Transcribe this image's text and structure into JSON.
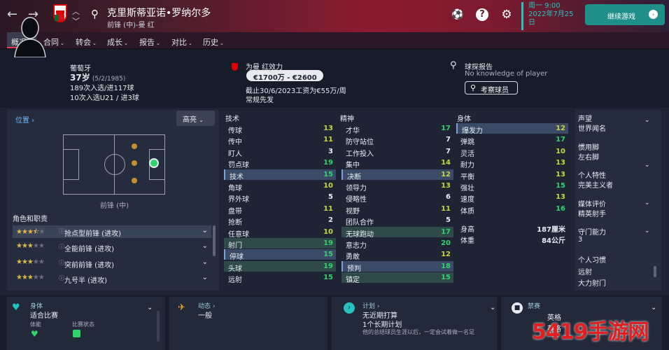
{
  "topbar": {
    "back": "←",
    "forward": "→",
    "player_name": "克里斯蒂亚诺•罗纳尔多",
    "player_sub": "前锋 (中)-曼 红",
    "date_line1": "周一 9:00",
    "date_line2": "2022年7月25",
    "date_line3": "日",
    "continue": "继续游戏"
  },
  "tabs": [
    {
      "label": "概况"
    },
    {
      "label": "合同"
    },
    {
      "label": "转会"
    },
    {
      "label": "成长"
    },
    {
      "label": "报告"
    },
    {
      "label": "对比"
    },
    {
      "label": "历史"
    }
  ],
  "header": {
    "nationality": "葡萄牙",
    "age": "37岁",
    "dob": "(5/2/1985)",
    "caps": "189次入选/进117球",
    "u21": "10次入选U21 / 进3球",
    "club_label": "为曼 红效力",
    "value": "€1700万 - €2600万",
    "contract": "截止30/6/2023工资为€55万/周",
    "squad_role": "常规先发",
    "scout_title": "球探报告",
    "scout_text": "No knowledge of player",
    "scout_btn": "考察球员"
  },
  "position": {
    "label": "位置",
    "highlight": "高亮",
    "pos_name": "前锋 (中)",
    "roles_title": "角色和职责"
  },
  "roles": [
    {
      "stars": 3.5,
      "name": "抢点型前锋 (进攻)"
    },
    {
      "stars": 3,
      "name": "全能前锋 (进攻)"
    },
    {
      "stars": 3,
      "name": "突前前锋 (进攻)"
    },
    {
      "stars": 3,
      "name": "九号半 (进攻)"
    }
  ],
  "tech": {
    "title": "技术",
    "rows": [
      [
        "传球",
        13
      ],
      [
        "传中",
        11
      ],
      [
        "盯人",
        3
      ],
      [
        "罚点球",
        19
      ],
      [
        "技术",
        15
      ],
      [
        "角球",
        10
      ],
      [
        "界外球",
        5
      ],
      [
        "盘带",
        11
      ],
      [
        "抢断",
        2
      ],
      [
        "任意球",
        10
      ],
      [
        "射门",
        19
      ],
      [
        "停球",
        15
      ],
      [
        "头球",
        19
      ],
      [
        "远射",
        15
      ]
    ]
  },
  "mental": {
    "title": "精神",
    "rows": [
      [
        "才华",
        17
      ],
      [
        "防守站位",
        7
      ],
      [
        "工作投入",
        7
      ],
      [
        "集中",
        14
      ],
      [
        "决断",
        12
      ],
      [
        "领导力",
        13
      ],
      [
        "侵略性",
        6
      ],
      [
        "视野",
        11
      ],
      [
        "团队合作",
        5
      ],
      [
        "无球跑动",
        17
      ],
      [
        "意志力",
        20
      ],
      [
        "勇敢",
        12
      ],
      [
        "预判",
        18
      ],
      [
        "镇定",
        15
      ]
    ]
  },
  "physical": {
    "title": "身体",
    "rows": [
      [
        "爆发力",
        12
      ],
      [
        "弹跳",
        17
      ],
      [
        "灵活",
        10
      ],
      [
        "耐力",
        13
      ],
      [
        "平衡",
        13
      ],
      [
        "强壮",
        15
      ],
      [
        "速度",
        13
      ],
      [
        "体质",
        16
      ]
    ],
    "height_label": "身高",
    "height": "187厘米",
    "weight_label": "体重",
    "weight": "84公斤"
  },
  "side": [
    {
      "label": "声望",
      "value": "世界闻名"
    },
    {
      "label": "惯用脚",
      "value": "左右脚"
    },
    {
      "label": "个人特性",
      "value": "完美主义者"
    },
    {
      "label": "媒体评价",
      "value": "精英射手"
    },
    {
      "label": "守门能力",
      "value": "3"
    },
    {
      "label": "个人习惯",
      "value": "远射"
    },
    {
      "label": "",
      "value": "大力射门"
    }
  ],
  "bottom": {
    "fitness_title": "身体",
    "fitness_val": "适合比赛",
    "fit_lbl1": "体能",
    "fit_lbl2": "比赛状态",
    "dyn_title": "动态",
    "dyn_val": "一般",
    "plan_title": "计划",
    "plan_l1": "无近期打算",
    "plan_l2": "1个长期计划",
    "plan_l3": "他的总结球员生涯以后，一定会试着做一名足",
    "ban_title": "禁赛",
    "ban_l1": "英格",
    "ban_l2": "英格",
    "wm": "5419手游网"
  },
  "colors": {
    "accent_teal": "#25c4c1",
    "green": "#2fd46a",
    "yellow": "#c8d83a",
    "brand_red": "#8c1b31"
  }
}
